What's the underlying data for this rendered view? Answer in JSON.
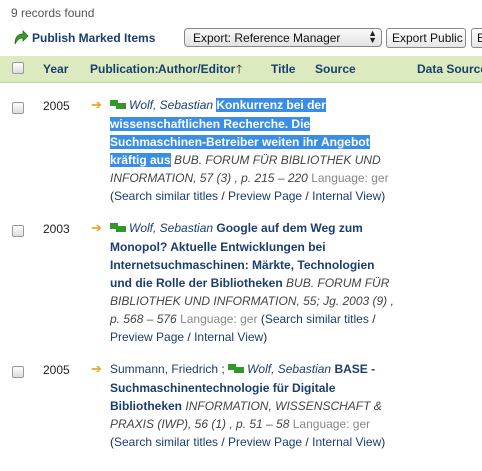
{
  "records_found": "9 records found",
  "toolbar": {
    "publish_label": "Publish Marked Items",
    "export_value": "Export: Reference Manager",
    "export_public_label": "Export Public",
    "export_label": "Ex"
  },
  "header": {
    "year": "Year",
    "publication": "Publication:",
    "author_editor": "Author/Editor",
    "title": "Title",
    "source": "Source",
    "data_source": "Data Source"
  },
  "records": [
    {
      "year": "2005",
      "prefix_author": "",
      "flag_author": "Wolf, Sebastian",
      "title": "Konkurrenz bei der wissenschaftlichen Recherche. Die Suchmaschinen-Betreiber weiten ihr Angebot kräftig aus",
      "source": "BUB. FORUM FÜR BIBLIOTHEK UND INFORMATION, 57 (3) , p. 215 – 220",
      "language": "Language: ger",
      "search_similar": "Search similar titles",
      "preview": "Preview Page",
      "internal": "Internal View"
    },
    {
      "year": "2003",
      "prefix_author": "",
      "flag_author": "Wolf, Sebastian",
      "title": "Google auf dem Weg zum Monopol? Aktuelle Entwicklungen bei Internetsuchmaschinen: Märkte, Technologien und die Rolle der Bibliotheken",
      "source": "BUB. FORUM FÜR BIBLIOTHEK UND INFORMATION, 55; Jg. 2003 (9) , p. 568 – 576",
      "language": "Language: ger",
      "search_similar": "Search similar titles",
      "preview": "Preview Page",
      "internal": "Internal View"
    },
    {
      "year": "2005",
      "prefix_author": "Summann, Friedrich",
      "flag_author": "Wolf, Sebastian",
      "title": "BASE - Suchmaschinentechnologie für Digitale Bibliotheken",
      "source": "INFORMATION, WISSENSCHAFT & PRAXIS (IWP), 56 (1) , p. 51 – 58",
      "language": "Language: ger",
      "search_similar": "Search similar titles",
      "preview": "Preview Page",
      "internal": "Internal View"
    }
  ]
}
